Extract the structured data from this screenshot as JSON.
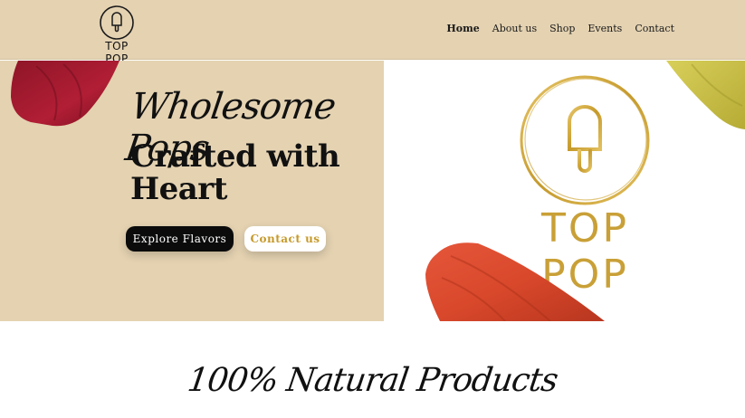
{
  "brand": {
    "name": "TOP POP",
    "big_logo_text": "TOP POP"
  },
  "nav": {
    "items": [
      {
        "label": "Home",
        "active": true
      },
      {
        "label": "About us"
      },
      {
        "label": "Shop"
      },
      {
        "label": "Events"
      },
      {
        "label": "Contact"
      }
    ]
  },
  "hero": {
    "script_title": "Wholesome Pops",
    "title": "Crafted with Heart",
    "primary_button": "Explore Flavors",
    "secondary_button": "Contact us"
  },
  "section": {
    "heading": "100% Natural Products"
  },
  "colors": {
    "beige": "#e4d2b1",
    "gold": "#c69a2b",
    "dark": "#0b0b0b",
    "popsicle_red": "#e0532f",
    "popsicle_berry": "#a01c32",
    "popsicle_yellow": "#c9c04a"
  },
  "icons": {
    "logo": "popsicle-icon"
  }
}
